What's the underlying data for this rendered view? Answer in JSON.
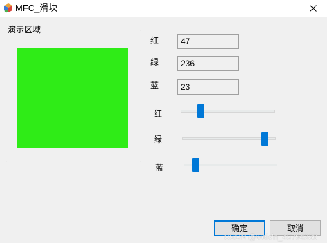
{
  "window": {
    "title": "MFC_滑块",
    "app_icon": "mfc-app-icon",
    "close_icon": "close-icon"
  },
  "group": {
    "label": "演示区域"
  },
  "preview": {
    "color": "#2fec17",
    "rgb": [
      47,
      236,
      23
    ]
  },
  "fields": [
    {
      "label": "红",
      "value": "47"
    },
    {
      "label": "绿",
      "value": "236"
    },
    {
      "label": "蓝",
      "value": "23"
    }
  ],
  "sliders": [
    {
      "label": "红",
      "value": 47,
      "min": 0,
      "max": 255
    },
    {
      "label": "绿",
      "value": 236,
      "min": 0,
      "max": 255
    },
    {
      "label": "蓝",
      "value": 23,
      "min": 0,
      "max": 255
    }
  ],
  "buttons": {
    "ok": "确定",
    "cancel": "取消"
  },
  "watermark": "CSDN @weixin_45794330",
  "colors": {
    "accent": "#0078d7",
    "background": "#f0f0f0"
  }
}
